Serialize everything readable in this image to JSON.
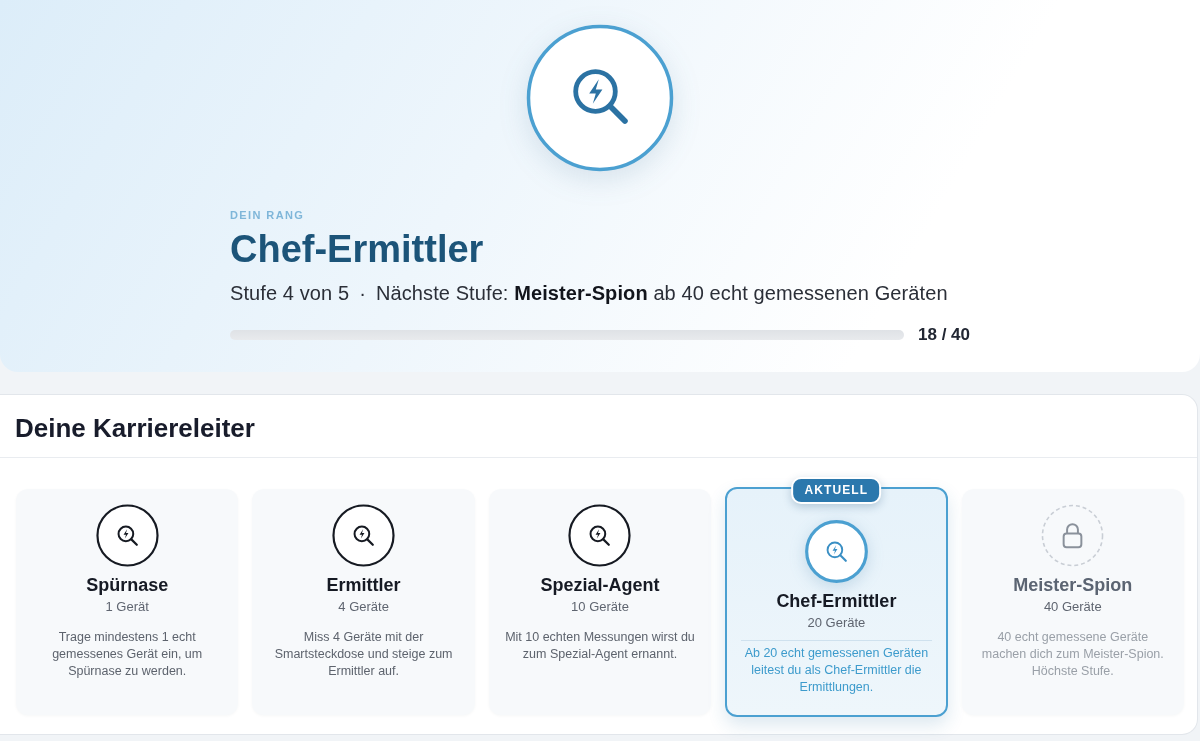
{
  "hero": {
    "eyebrow": "DEIN RANG",
    "rank": "Chef-Ermittler",
    "level_text": "Stufe 4 von 5",
    "separator": "·",
    "next_text": "Nächste Stufe: **Meister-Spion** ab 40 echt gemessenen Geräten",
    "progress": {
      "reading": "18 / 40"
    }
  },
  "ladder": {
    "title": "Deine Karriereleiter",
    "ranks": [
      {
        "kind": "achieved",
        "name": "Spürnase",
        "requirement": "1 Gerät",
        "description": "Trage mindestens 1 echt gemessenes Gerät ein, um Spürnase zu werden."
      },
      {
        "kind": "achieved",
        "name": "Ermittler",
        "requirement": "4 Geräte",
        "description": "Miss 4 Geräte mit der Smartsteckdose und steige zum Ermittler auf."
      },
      {
        "kind": "achieved",
        "name": "Spezial-Agent",
        "requirement": "10 Geräte",
        "description": "Mit 10 echten Messungen wirst du zum Spezial-Agent ernannt."
      },
      {
        "kind": "current",
        "badge": "AKTUELL",
        "name": "Chef-Ermittler",
        "requirement": "20 Geräte",
        "description": "Ab 20 echt gemessenen Geräten leitest du als Chef-Ermittler die Ermittlungen."
      },
      {
        "kind": "locked",
        "name": "Meister-Spion",
        "requirement": "40 Geräte",
        "description": "40 echt gemessene Geräte machen dich zum Meister-Spion. Höchste Stufe."
      }
    ]
  }
}
